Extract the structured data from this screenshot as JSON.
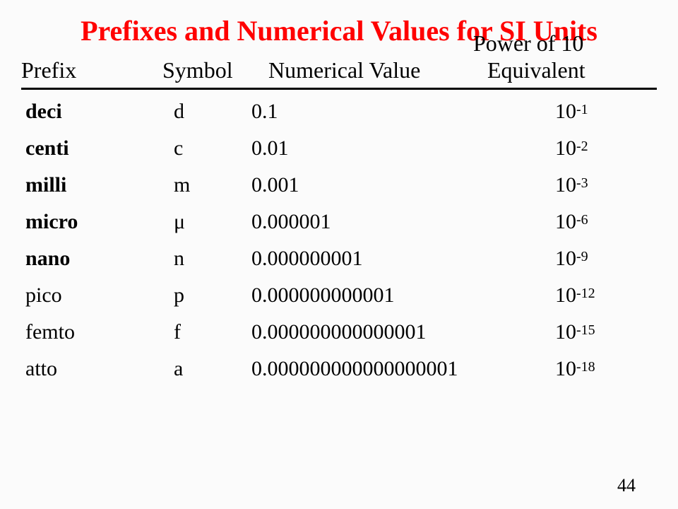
{
  "title": "Prefixes and Numerical Values for SI Units",
  "headers": {
    "prefix": "Prefix",
    "symbol": "Symbol",
    "value": "Numerical Value",
    "power_top": "Power of 10",
    "equivalent": "Equivalent"
  },
  "rows": [
    {
      "prefix": "deci",
      "bold": true,
      "symbol": "d",
      "value": "0.1",
      "base": "10",
      "exp": "-1"
    },
    {
      "prefix": "centi",
      "bold": true,
      "symbol": "c",
      "value": "0.01",
      "base": "10",
      "exp": "-2"
    },
    {
      "prefix": "milli",
      "bold": true,
      "symbol": "m",
      "value": "0.001",
      "base": "10",
      "exp": "-3"
    },
    {
      "prefix": "micro",
      "bold": true,
      "symbol": "μ",
      "value": "0.000001",
      "base": "10",
      "exp": "-6"
    },
    {
      "prefix": "nano",
      "bold": true,
      "symbol": "n",
      "value": "0.000000001",
      "base": "10",
      "exp": "-9"
    },
    {
      "prefix": "pico",
      "bold": false,
      "symbol": "p",
      "value": "0.000000000001",
      "base": "10",
      "exp": "-12"
    },
    {
      "prefix": "femto",
      "bold": false,
      "symbol": "f",
      "value": "0.000000000000001",
      "base": "10",
      "exp": "-15"
    },
    {
      "prefix": "atto",
      "bold": false,
      "symbol": "a",
      "value": "0.000000000000000001",
      "base": "10",
      "exp": "-18"
    }
  ],
  "page_number": "44"
}
